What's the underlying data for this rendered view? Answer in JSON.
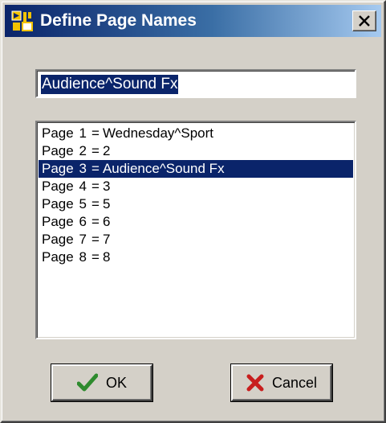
{
  "window": {
    "title": "Define Page Names",
    "close_label": "×"
  },
  "name_field": {
    "value": "Audience^Sound Fx"
  },
  "page_list": {
    "items": [
      {
        "prefix": "Page",
        "number": "1",
        "name": "Wednesday^Sport",
        "selected": false
      },
      {
        "prefix": "Page",
        "number": "2",
        "name": "2",
        "selected": false
      },
      {
        "prefix": "Page",
        "number": "3",
        "name": "Audience^Sound Fx",
        "selected": true
      },
      {
        "prefix": "Page",
        "number": "4",
        "name": "3",
        "selected": false
      },
      {
        "prefix": "Page",
        "number": "5",
        "name": "5",
        "selected": false
      },
      {
        "prefix": "Page",
        "number": "6",
        "name": "6",
        "selected": false
      },
      {
        "prefix": "Page",
        "number": "7",
        "name": "7",
        "selected": false
      },
      {
        "prefix": "Page",
        "number": "8",
        "name": "8",
        "selected": false
      }
    ]
  },
  "buttons": {
    "ok_label": "OK",
    "cancel_label": "Cancel"
  },
  "colors": {
    "dialog_face": "#d4d0c8",
    "title_start": "#0a246a",
    "title_end": "#a6caf0",
    "selection": "#0a246a",
    "ok_check": "#2e8b2e",
    "cancel_x": "#c81e1e"
  },
  "icons": {
    "app": "page-names-app-icon",
    "close": "close-icon",
    "ok": "checkmark-icon",
    "cancel": "red-x-icon"
  }
}
